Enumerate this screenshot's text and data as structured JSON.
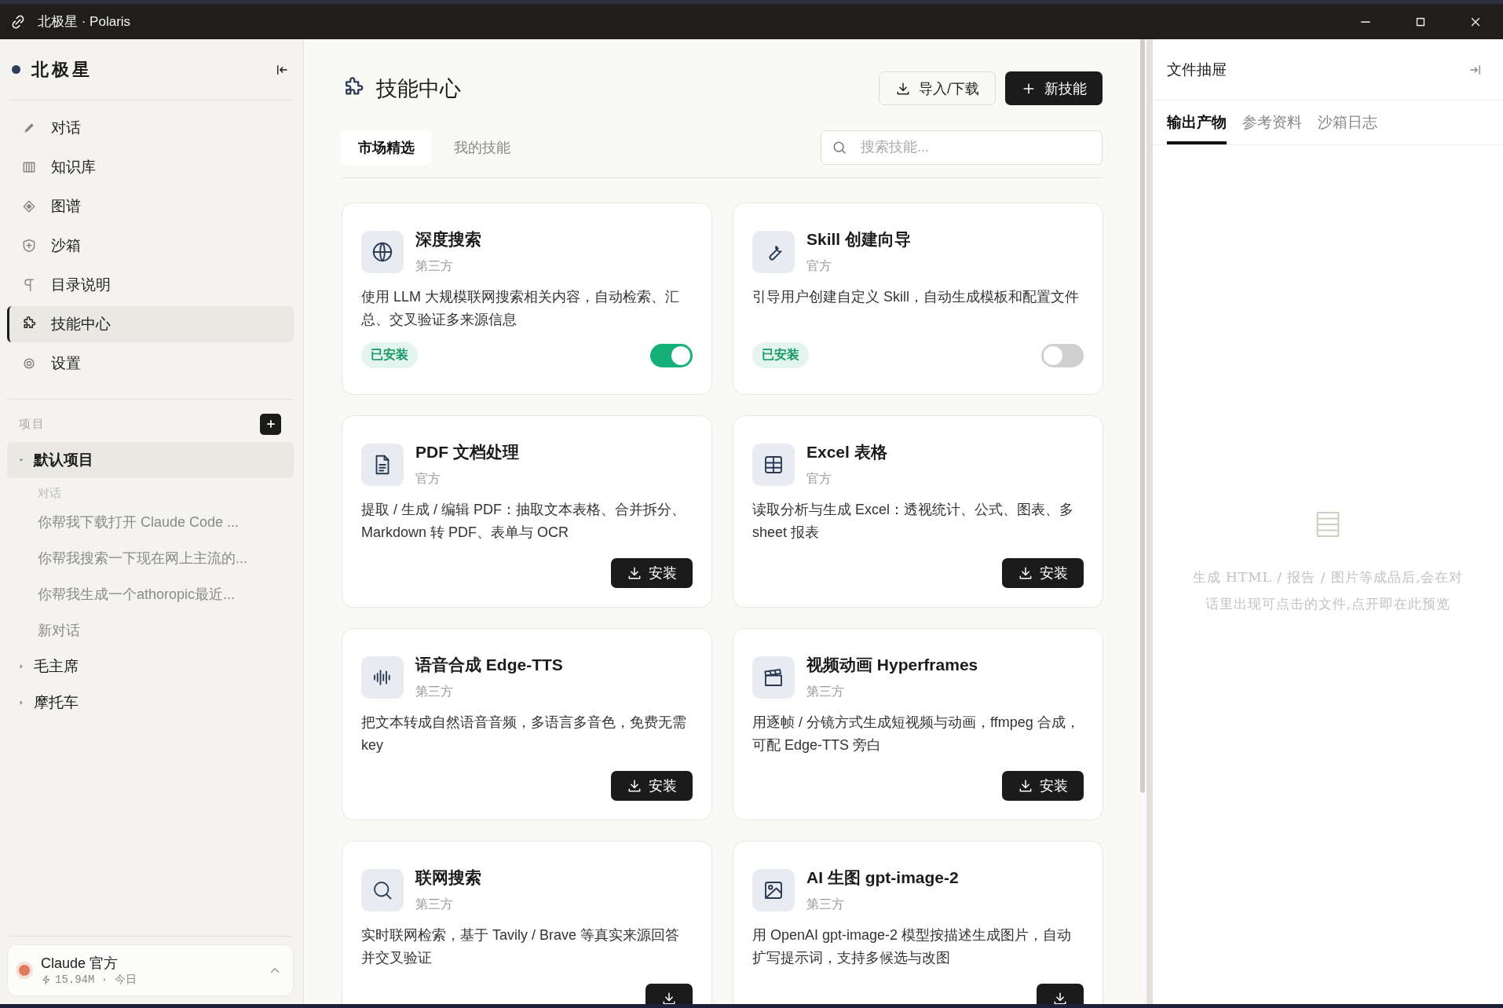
{
  "window": {
    "title": "北极星 · Polaris"
  },
  "sidebar": {
    "brand": "北极星",
    "nav": [
      {
        "label": "对话",
        "selected": false
      },
      {
        "label": "知识库",
        "selected": false
      },
      {
        "label": "图谱",
        "selected": false
      },
      {
        "label": "沙箱",
        "selected": false
      },
      {
        "label": "目录说明",
        "selected": false
      },
      {
        "label": "技能中心",
        "selected": true
      },
      {
        "label": "设置",
        "selected": false
      }
    ],
    "projects_label": "项目",
    "projects": [
      {
        "name": "默认项目",
        "expanded": true,
        "section": "对话",
        "children": [
          {
            "title": "你帮我下载打开 Claude Code ..."
          },
          {
            "title": "你帮我搜索一下现在网上主流的..."
          },
          {
            "title": "你帮我生成一个athoropic最近..."
          },
          {
            "title": "新对话"
          }
        ]
      },
      {
        "name": "毛主席",
        "expanded": false
      },
      {
        "name": "摩托车",
        "expanded": false
      }
    ],
    "account": {
      "name": "Claude 官方",
      "usage": "15.94M · 今日",
      "color": "#e07a5f"
    }
  },
  "main": {
    "title": "技能中心",
    "import_button": "导入/下载",
    "new_button": "新技能",
    "tabs": [
      {
        "label": "市场精选",
        "selected": true
      },
      {
        "label": "我的技能",
        "selected": false
      }
    ],
    "search": {
      "placeholder": "搜索技能..."
    },
    "cards": [
      {
        "title": "深度搜索",
        "source": "第三方",
        "description": "使用 LLM 大规模联网搜索相关内容，自动检索、汇总、交叉验证多来源信息",
        "installed": true,
        "badge": "已安装",
        "enabled": true
      },
      {
        "title": "Skill 创建向导",
        "source": "官方",
        "description": "引导用户创建自定义 Skill，自动生成模板和配置文件",
        "installed": true,
        "badge": "已安装",
        "enabled": false
      },
      {
        "title": "PDF 文档处理",
        "source": "官方",
        "description": "提取 / 生成 / 编辑 PDF：抽取文本表格、合并拆分、Markdown 转 PDF、表单与 OCR",
        "installed": false,
        "button": "安装"
      },
      {
        "title": "Excel 表格",
        "source": "官方",
        "description": "读取分析与生成 Excel：透视统计、公式、图表、多 sheet 报表",
        "installed": false,
        "button": "安装"
      },
      {
        "title": "语音合成 Edge-TTS",
        "source": "第三方",
        "description": "把文本转成自然语音音频，多语言多音色，免费无需 key",
        "installed": false,
        "button": "安装"
      },
      {
        "title": "视频动画 Hyperframes",
        "source": "第三方",
        "description": "用逐帧 / 分镜方式生成短视频与动画，ffmpeg 合成，可配 Edge-TTS 旁白",
        "installed": false,
        "button": "安装"
      },
      {
        "title": "联网搜索",
        "source": "第三方",
        "description": "实时联网检索，基于 Tavily / Brave 等真实来源回答并交叉验证",
        "installed": false
      },
      {
        "title": "AI 生图 gpt-image-2",
        "source": "第三方",
        "description": "用 OpenAI gpt-image-2 模型按描述生成图片，自动扩写提示词，支持多候选与改图",
        "installed": false
      }
    ]
  },
  "drawer": {
    "title": "文件抽屉",
    "tabs": [
      {
        "label": "输出产物",
        "selected": true
      },
      {
        "label": "参考资料",
        "selected": false
      },
      {
        "label": "沙箱日志",
        "selected": false
      }
    ],
    "empty_text": "生成 HTML / 报告 / 图片等成品后,会在对话里出现可点击的文件,点开即在此预览"
  }
}
